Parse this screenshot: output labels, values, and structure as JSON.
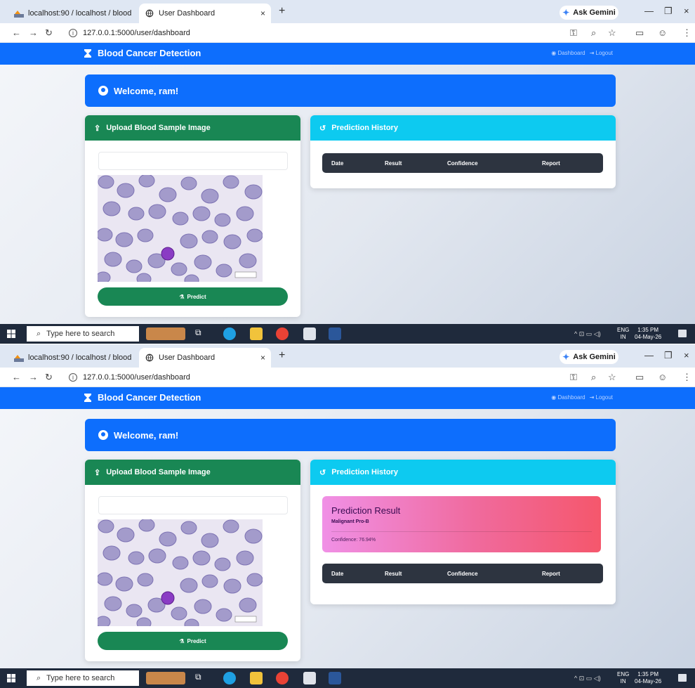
{
  "browser": {
    "tab_inactive_title": "localhost:90 / localhost / blood",
    "tab_active_title": "User Dashboard",
    "new_tab": "+",
    "url": "127.0.0.1:5000/user/dashboard",
    "gemini_label": "Ask Gemini",
    "window_controls": {
      "minimize": "—",
      "maximize": "❐",
      "close": "×"
    }
  },
  "app": {
    "brand": "Blood Cancer Detection",
    "nav_dashboard": "Dashboard",
    "nav_logout": "Logout",
    "welcome": "Welcome, ram!",
    "upload_title": "Upload Blood Sample Image",
    "predict_label": "Predict",
    "history_title": "Prediction History",
    "table_headers": [
      "Date",
      "Result",
      "Confidence",
      "Report"
    ],
    "result": {
      "title": "Prediction Result",
      "label": "Malignant Pro-B",
      "confidence": "Confidence: 76.94%"
    }
  },
  "taskbar": {
    "search_placeholder": "Type here to search",
    "lang_top": "ENG",
    "lang_bottom": "IN",
    "time": "1:35 PM",
    "date": "04-May-26"
  },
  "colors": {
    "primary_blue": "#0d6efd",
    "success_green": "#198754",
    "info_cyan": "#0dcaf0",
    "table_header_dark": "#2d3440",
    "result_gradient_start": "#f090e6",
    "result_gradient_end": "#f5576c"
  }
}
